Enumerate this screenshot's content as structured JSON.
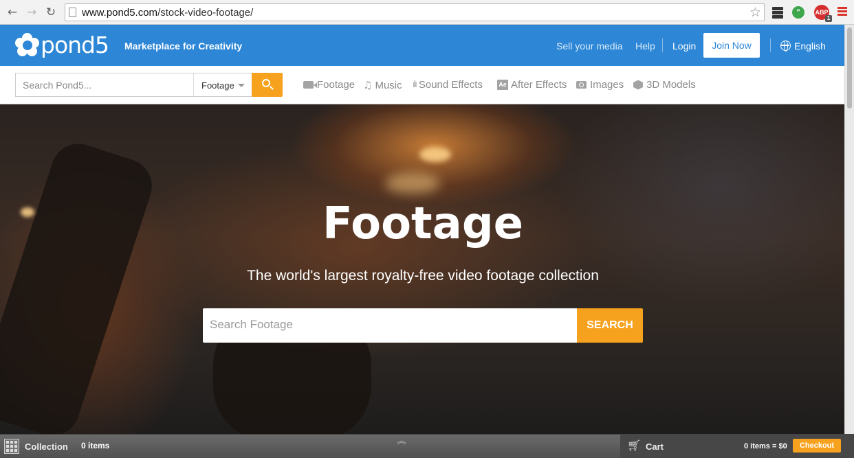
{
  "browser": {
    "back_glyph": "←",
    "forward_glyph": "→",
    "reload_glyph": "↻",
    "url_host": "www.pond5.com",
    "url_path": "/stock-video-footage/",
    "star_glyph": "☆",
    "evernote_label": "",
    "abp_label": "ABP",
    "abp_count": "1"
  },
  "header": {
    "logo_text": "pond5",
    "tagline": "Marketplace for Creativity",
    "sell_link": "Sell your media",
    "help_link": "Help",
    "login_link": "Login",
    "join_button": "Join Now",
    "language": "English",
    "brand_color": "#2d87d6"
  },
  "nav": {
    "search_placeholder": "Search Pond5...",
    "search_scope": "Footage",
    "categories": [
      {
        "label": "Footage",
        "icon": "video-camera-icon"
      },
      {
        "label": "Music",
        "icon": "music-note-icon"
      },
      {
        "label": "Sound Effects",
        "icon": "sound-wave-icon"
      },
      {
        "label": "After Effects",
        "icon": "after-effects-icon"
      },
      {
        "label": "Images",
        "icon": "camera-icon"
      },
      {
        "label": "3D Models",
        "icon": "cube-icon"
      }
    ],
    "accent_color": "#f7a21e"
  },
  "hero": {
    "title": "Footage",
    "subtitle": "The world's largest royalty-free video footage collection",
    "search_placeholder": "Search Footage",
    "search_button": "SEARCH"
  },
  "bottom_bar": {
    "collection_label": "Collection",
    "collection_items": "0 items",
    "cart_label": "Cart",
    "cart_summary": "0 items = $0",
    "checkout_button": "Checkout"
  }
}
